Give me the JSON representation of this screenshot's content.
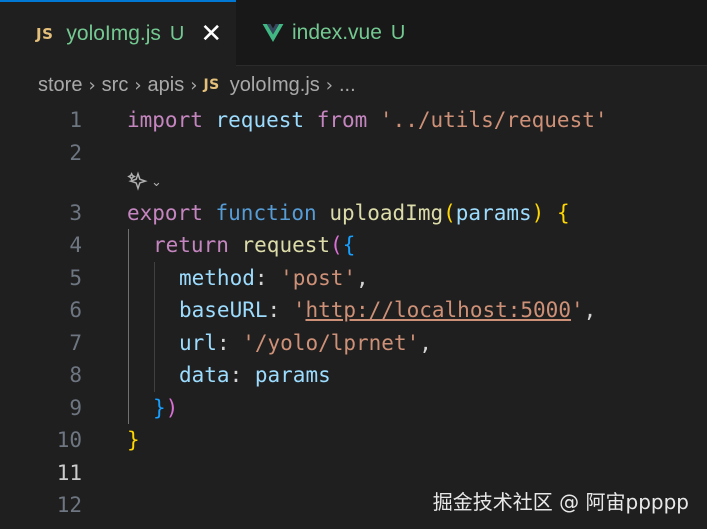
{
  "tabs": [
    {
      "icon": "JS",
      "name": "yoloImg.js",
      "status": "U",
      "close": "✕",
      "active": true
    },
    {
      "icon": "vue-icon",
      "name": "index.vue",
      "status": "U",
      "active": false
    }
  ],
  "breadcrumb": {
    "parts": [
      "store",
      "src",
      "apis"
    ],
    "file_icon": "JS",
    "file": "yoloImg.js",
    "ellipsis": "..."
  },
  "gutter": [
    "1",
    "2",
    "3",
    "4",
    "5",
    "6",
    "7",
    "8",
    "9",
    "10",
    "11",
    "12"
  ],
  "code": {
    "l1": {
      "import": "import",
      "request": "request",
      "from": "from",
      "path": "'../utils/request'"
    },
    "l3": {
      "export": "export",
      "function": "function",
      "name": "uploadImg",
      "open": "(",
      "param": "params",
      "close": ")",
      "brace": "{"
    },
    "l4": {
      "return": "return",
      "fn": "request",
      "paren": "(",
      "brace": "{"
    },
    "l5": {
      "key": "method",
      "colon": ": ",
      "value": "'post'",
      "comma": ","
    },
    "l6": {
      "key": "baseURL",
      "colon": ": ",
      "q1": "'",
      "url": "http://localhost:5000",
      "q2": "'",
      "comma": ","
    },
    "l7": {
      "key": "url",
      "colon": ": ",
      "value": "'/yolo/lprnet'",
      "comma": ","
    },
    "l8": {
      "key": "data",
      "colon": ": ",
      "value": "params"
    },
    "l9": {
      "brace": "}",
      "paren": ")"
    },
    "l10": {
      "brace": "}"
    }
  },
  "colors": {
    "keyword": "#569cd6",
    "control": "#c586c0",
    "variable": "#9cdcfe",
    "function": "#dcdcaa",
    "string": "#ce9178",
    "bracket1": "#ffd700",
    "bracket2": "#da70d6",
    "bracket3": "#179fff",
    "untracked": "#73c991",
    "active_tab_border": "#0078d4"
  },
  "watermark": "掘金技术社区 @ 阿宙ppppp"
}
